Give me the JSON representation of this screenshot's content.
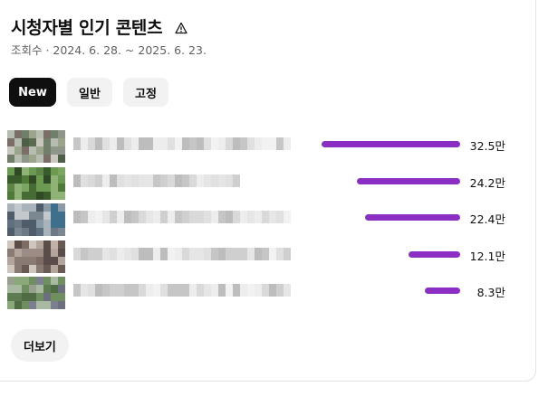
{
  "header": {
    "title": "시청자별 인기 콘텐츠",
    "warning_icon": "warning-triangle-icon",
    "subtitle": "조회수 · 2024. 6. 28. ~ 2025. 6. 23."
  },
  "filters": [
    {
      "label": "New",
      "selected": true
    },
    {
      "label": "일반",
      "selected": false
    },
    {
      "label": "고정",
      "selected": false
    }
  ],
  "colors": {
    "bar": "#8b2fc4",
    "chip_selected_bg": "#0f0f0f",
    "chip_bg": "#f2f2f2",
    "text_primary": "#0f0f0f",
    "text_secondary": "#606060"
  },
  "items": [
    {
      "views": "32.5만",
      "value": 32.5
    },
    {
      "views": "24.2만",
      "value": 24.2
    },
    {
      "views": "22.4만",
      "value": 22.4
    },
    {
      "views": "12.1만",
      "value": 12.1
    },
    {
      "views": "8.3만",
      "value": 8.3
    }
  ],
  "more_button": {
    "label": "더보기"
  }
}
